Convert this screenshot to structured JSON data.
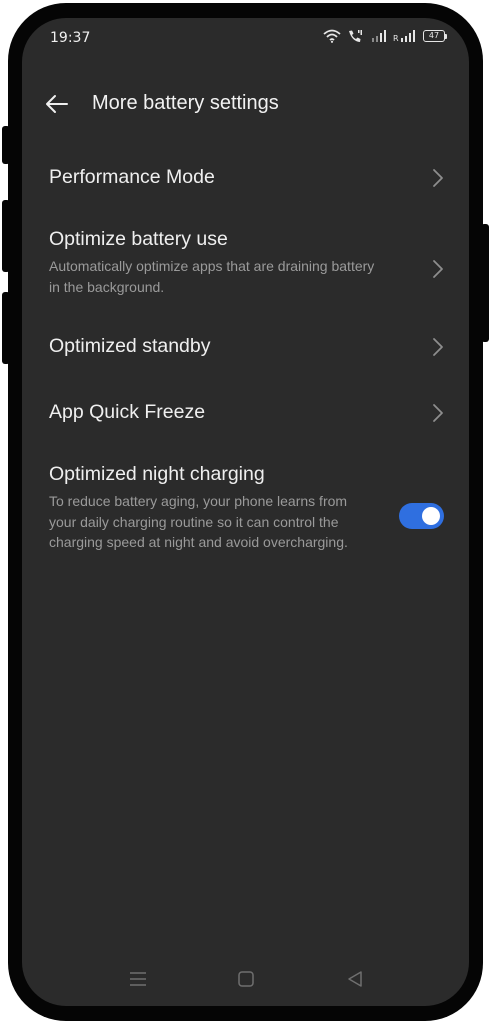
{
  "status_bar": {
    "time": "19:37",
    "battery_level": "47",
    "icons": [
      "wifi-icon",
      "call-icon",
      "signal-icon",
      "signal-r-icon",
      "battery-icon"
    ]
  },
  "app_bar": {
    "back_icon": "arrow-left-icon",
    "title": "More battery settings"
  },
  "settings": {
    "performance_mode": {
      "title": "Performance Mode"
    },
    "optimize_battery": {
      "title": "Optimize battery use",
      "subtitle": "Automatically optimize apps that are draining battery in the background."
    },
    "optimized_standby": {
      "title": "Optimized standby"
    },
    "app_quick_freeze": {
      "title": "App Quick Freeze"
    },
    "night_charging": {
      "title": "Optimized night charging",
      "subtitle": "To reduce battery aging, your phone learns from your daily charging routine so it can control the charging speed at night and avoid overcharging.",
      "enabled": true
    }
  },
  "nav_bar": {
    "icons": [
      "menu-icon",
      "home-square-icon",
      "back-triangle-icon"
    ]
  },
  "colors": {
    "background": "#2b2b2b",
    "accent": "#2f6fe0",
    "text_primary": "#efefef",
    "text_secondary": "#9a9a9a"
  }
}
